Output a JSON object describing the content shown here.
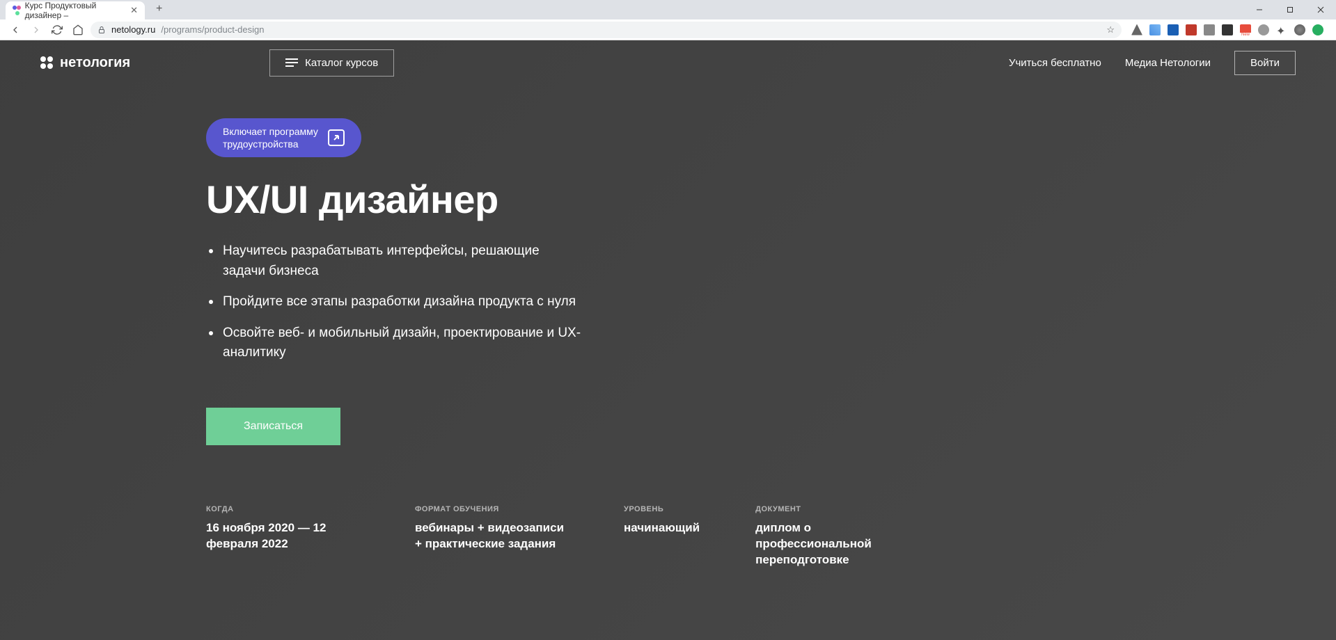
{
  "browser": {
    "tab_title": "Курс Продуктовый дизайнер –",
    "url_domain": "netology.ru",
    "url_path": "/programs/product-design"
  },
  "header": {
    "logo_text": "нетология",
    "catalog_label": "Каталог курсов",
    "nav": {
      "free_learning": "Учиться бесплатно",
      "media": "Медиа Нетологии"
    },
    "login_label": "Войти"
  },
  "hero": {
    "badge_line1": "Включает программу",
    "badge_line2": "трудоустройства",
    "title": "UX/UI дизайнер",
    "bullets": [
      "Научитесь разрабатывать интерфейсы, решающие задачи бизнеса",
      "Пройдите все этапы разработки дизайна продукта с нуля",
      "Освойте веб- и мобильный дизайн, проектирование и UX-аналитику"
    ],
    "cta_label": "Записаться"
  },
  "info": [
    {
      "label": "КОГДА",
      "value": "16 ноября 2020 — 12 февраля 2022"
    },
    {
      "label": "ФОРМАТ ОБУЧЕНИЯ",
      "value": "вебинары + видеозаписи + практические задания"
    },
    {
      "label": "УРОВЕНЬ",
      "value": "начинающий"
    },
    {
      "label": "ДОКУМЕНТ",
      "value": "диплом о профессиональной переподготовке"
    }
  ]
}
